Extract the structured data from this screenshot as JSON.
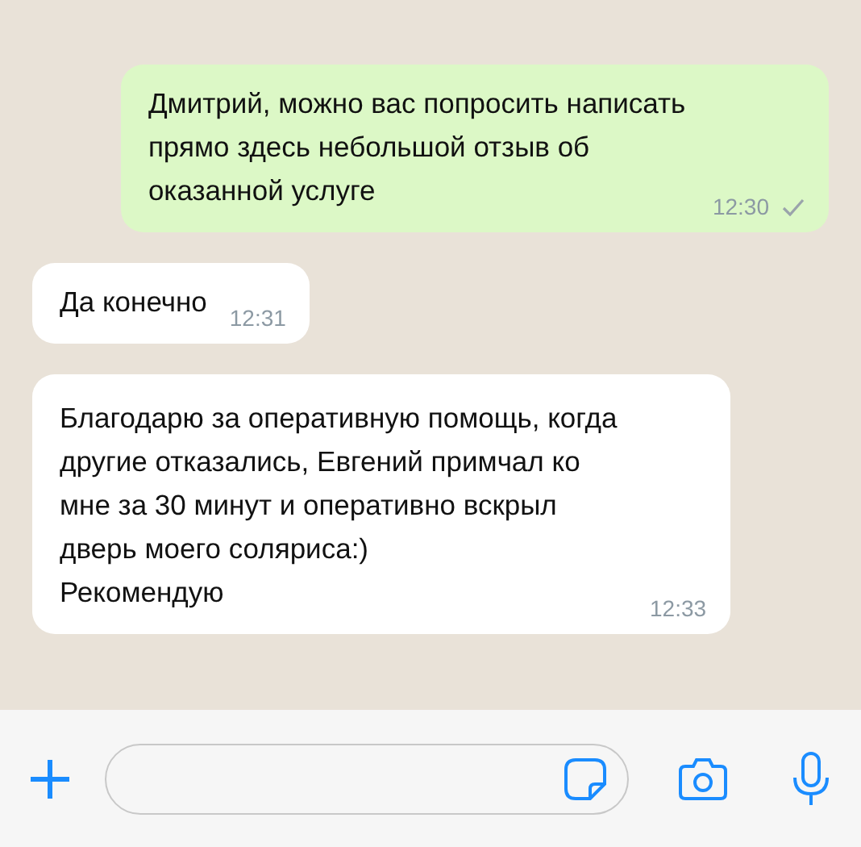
{
  "messages": [
    {
      "outgoing": true,
      "text": "Дмитрий, можно вас попросить написать прямо здесь небольшой отзыв об оказанной услуге",
      "time": "12:30",
      "delivered": true
    },
    {
      "outgoing": false,
      "text": "Да конечно",
      "time": "12:31"
    },
    {
      "outgoing": false,
      "text": "Благодарю за оперативную помощь, когда другие отказались, Евгений примчал ко мне за 30 минут и оперативно вскрыл дверь моего соляриса:)\nРекомендую",
      "time": "12:33"
    }
  ]
}
